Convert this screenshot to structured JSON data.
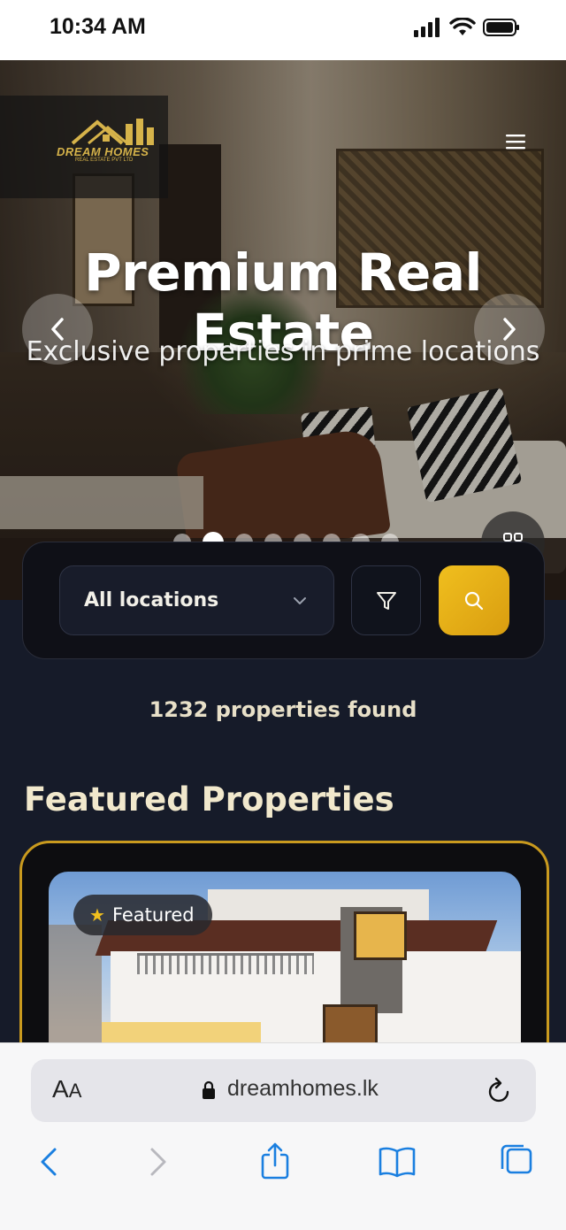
{
  "status_bar": {
    "time": "10:34 AM"
  },
  "header": {
    "logo_text": "DREAM HOMES",
    "logo_subtext": "REAL ESTATE PVT LTD",
    "menu_icon": "hamburger-icon"
  },
  "hero": {
    "title": "Premium Real Estate",
    "subtitle": "Exclusive properties in prime locations",
    "slide_count": 8,
    "active_slide": 1
  },
  "search": {
    "location_value": "All locations",
    "location_icon": "chevron-down-icon",
    "filter_icon": "filter-icon",
    "search_icon": "search-icon"
  },
  "results": {
    "count_text": "1232 properties found"
  },
  "featured": {
    "section_title": "Featured Properties",
    "badge_label": "Featured",
    "badge_icon": "star-icon"
  },
  "browser": {
    "aa_label_big": "A",
    "aa_label_small": "A",
    "url": "dreamhomes.lk"
  },
  "colors": {
    "accent_gold": "#f0bf1e",
    "page_background": "#161b29",
    "card_border": "#c99a1e"
  }
}
